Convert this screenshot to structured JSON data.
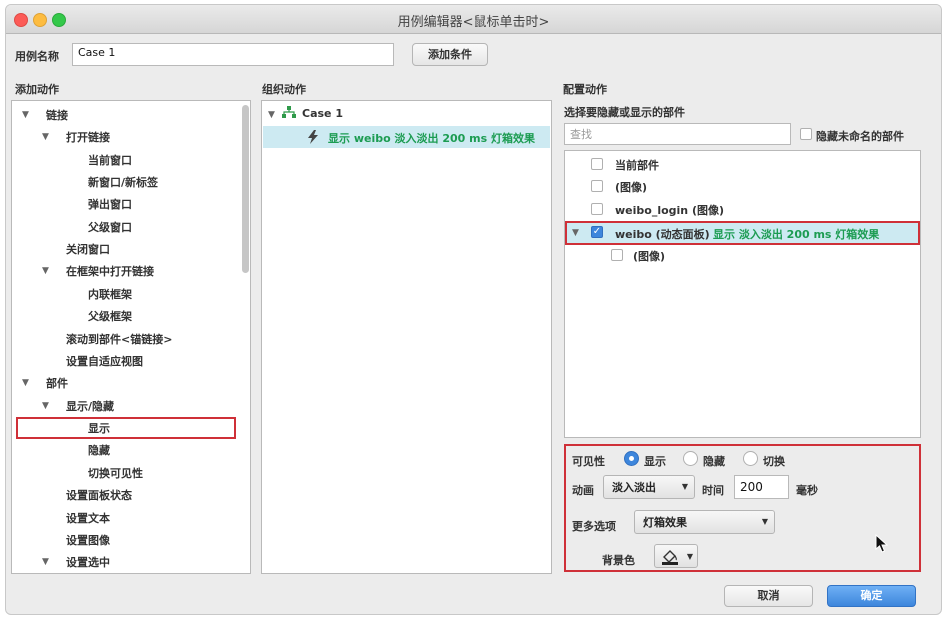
{
  "window": {
    "title": "用例编辑器<鼠标单击时>"
  },
  "case_name": {
    "label": "用例名称",
    "value": "Case 1",
    "add_condition": "添加条件"
  },
  "columns": {
    "add_action": "添加动作",
    "organize_action": "组织动作",
    "configure_action": "配置动作"
  },
  "add_tree": {
    "link": "链接",
    "open_link": "打开链接",
    "current_window": "当前窗口",
    "new_window": "新窗口/新标签",
    "popup": "弹出窗口",
    "parent_window": "父级窗口",
    "close_window": "关闭窗口",
    "open_in_frame": "在框架中打开链接",
    "inline_frame": "内联框架",
    "parent_frame": "父级框架",
    "scroll_to": "滚动到部件<锚链接>",
    "adaptive_view": "设置自适应视图",
    "widgets": "部件",
    "show_hide": "显示/隐藏",
    "show": "显示",
    "hide": "隐藏",
    "toggle": "切换可见性",
    "panel_state": "设置面板状态",
    "set_text": "设置文本",
    "set_image": "设置图像",
    "set_selected": "设置选中"
  },
  "organize_tree": {
    "case": "Case 1",
    "action": "显示 weibo 淡入淡出 200 ms 灯箱效果"
  },
  "configure": {
    "heading": "选择要隐藏或显示的部件",
    "search_placeholder": "查找",
    "hide_unnamed": "隐藏未命名的部件",
    "items": {
      "current": "当前部件",
      "image1": "(图像)",
      "weibo_login": "weibo_login (图像)",
      "weibo_name": "weibo (动态面板)",
      "weibo_action": "显示 淡入淡出 200 ms 灯箱效果",
      "image2": "(图像)"
    },
    "visibility_label": "可见性",
    "visibility_options": {
      "show": "显示",
      "hide": "隐藏",
      "toggle": "切换"
    },
    "visibility_selected": "显示",
    "animation_label": "动画",
    "animation_value": "淡入淡出",
    "time_label": "时间",
    "time_value": "200",
    "ms_label": "毫秒",
    "more_options_label": "更多选项",
    "more_options_value": "灯箱效果",
    "bg_label": "背景色"
  },
  "footer": {
    "cancel": "取消",
    "ok": "确定"
  },
  "colors": {
    "accent": "#3d86dc",
    "highlight_red": "#cf3038",
    "selected_row": "#cdeaf2",
    "green_text": "#1c9c52"
  }
}
